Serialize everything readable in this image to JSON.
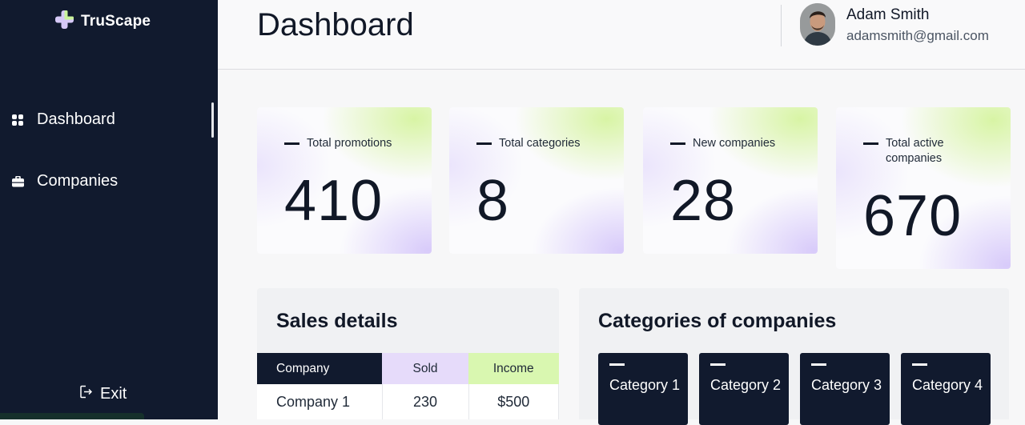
{
  "app": {
    "name": "TruScape"
  },
  "sidebar": {
    "items": [
      {
        "label": "Dashboard",
        "icon": "grid-icon"
      },
      {
        "label": "Companies",
        "icon": "briefcase-icon"
      }
    ],
    "exit_label": "Exit"
  },
  "header": {
    "title": "Dashboard",
    "user": {
      "name": "Adam Smith",
      "email": "adamsmith@gmail.com"
    }
  },
  "stats": [
    {
      "label": "Total promotions",
      "value": "410"
    },
    {
      "label": "Total categories",
      "value": "8"
    },
    {
      "label": "New companies",
      "value": "28"
    },
    {
      "label": "Total active companies",
      "value": "670"
    }
  ],
  "sales": {
    "title": "Sales details",
    "columns": [
      "Company",
      "Sold",
      "Income"
    ],
    "rows": [
      {
        "company": "Company 1",
        "sold": "230",
        "income": "$500"
      }
    ]
  },
  "categories": {
    "title": "Categories of companies",
    "items": [
      "Category 1",
      "Category 2",
      "Category 3",
      "Category 4"
    ]
  },
  "colors": {
    "sidebar_bg": "#111a2e",
    "accent_green": "#d9f7b0",
    "accent_purple": "#e6dbfa"
  }
}
